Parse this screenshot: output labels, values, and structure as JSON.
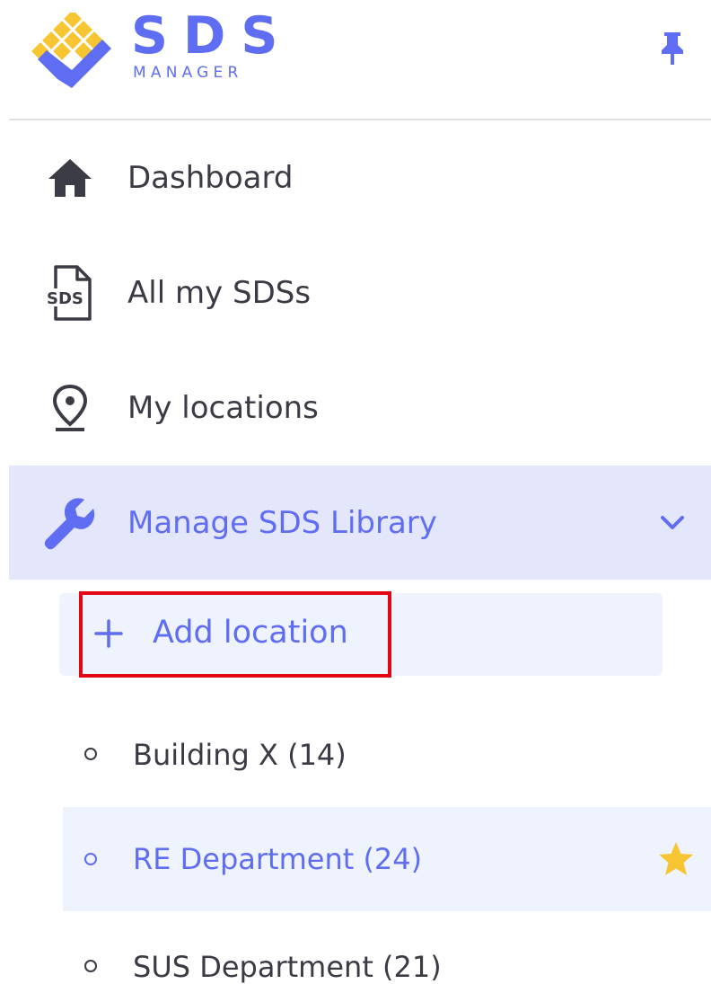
{
  "brand": {
    "name": "SDS",
    "subtitle": "MANAGER",
    "colors": {
      "primary": "#5f6df2",
      "accent": "#f7c531"
    }
  },
  "header": {
    "pin_icon": "pin-icon"
  },
  "nav": [
    {
      "label": "Dashboard",
      "icon": "home-icon"
    },
    {
      "label": "All my SDSs",
      "icon": "sds-document-icon"
    },
    {
      "label": "My locations",
      "icon": "location-pin-icon"
    },
    {
      "label": "Manage SDS Library",
      "icon": "wrench-icon",
      "active": true,
      "expanded": true
    }
  ],
  "library": {
    "add_label": "Add location",
    "locations": [
      {
        "label": "Building X (14)"
      },
      {
        "label": "RE Department (24)",
        "selected": true,
        "favorite": true
      },
      {
        "label": "SUS Department (21)"
      }
    ]
  }
}
